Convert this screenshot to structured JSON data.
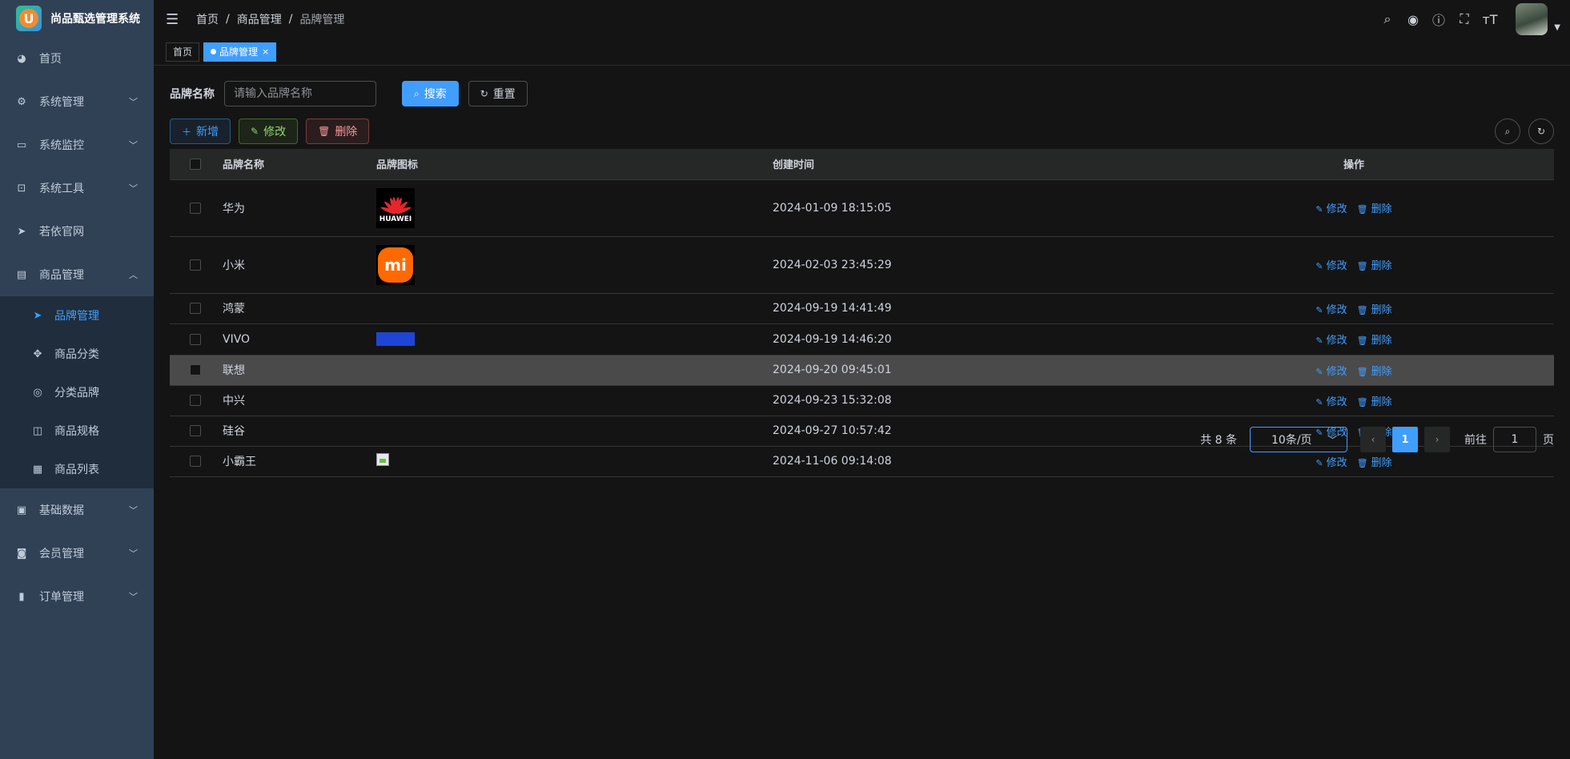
{
  "app": {
    "title": "尚品甄选管理系统",
    "logo_letter": "U"
  },
  "sidebar": {
    "items": [
      {
        "label": "首页",
        "icon": "dashboard-icon"
      },
      {
        "label": "系统管理",
        "icon": "gear-icon"
      },
      {
        "label": "系统监控",
        "icon": "monitor-icon"
      },
      {
        "label": "系统工具",
        "icon": "toolbox-icon"
      },
      {
        "label": "若依官网",
        "icon": "paper-plane-icon"
      },
      {
        "label": "商品管理",
        "icon": "calendar-icon"
      },
      {
        "label": "基础数据",
        "icon": "database-icon"
      },
      {
        "label": "会员管理",
        "icon": "member-icon"
      },
      {
        "label": "订单管理",
        "icon": "bar-chart-icon"
      }
    ],
    "submenu": [
      {
        "label": "品牌管理",
        "icon": "paper-plane-icon"
      },
      {
        "label": "商品分类",
        "icon": "move-icon"
      },
      {
        "label": "分类品牌",
        "icon": "swirl-icon"
      },
      {
        "label": "商品规格",
        "icon": "columns-icon"
      },
      {
        "label": "商品列表",
        "icon": "grid-icon"
      }
    ]
  },
  "navbar": {
    "breadcrumb": [
      "首页",
      "商品管理",
      "品牌管理"
    ],
    "icons": [
      "search-icon",
      "github-icon",
      "question-icon",
      "fullscreen-icon",
      "font-size-icon"
    ]
  },
  "tags": [
    {
      "label": "首页"
    },
    {
      "label": "品牌管理"
    }
  ],
  "search": {
    "label": "品牌名称",
    "placeholder": "请输入品牌名称",
    "search_label": "搜索",
    "reset_label": "重置"
  },
  "toolbar": {
    "add_label": "新增",
    "edit_label": "修改",
    "delete_label": "删除"
  },
  "table": {
    "headers": [
      "品牌名称",
      "品牌图标",
      "创建时间",
      "操作"
    ],
    "rows": [
      {
        "name": "华为",
        "logo": "huawei",
        "logo_text": "HUAWEI",
        "time": "2024-01-09 18:15:05"
      },
      {
        "name": "小米",
        "logo": "xiaomi",
        "logo_text": "mi",
        "time": "2024-02-03 23:45:29"
      },
      {
        "name": "鸿蒙",
        "logo": "none",
        "logo_text": "",
        "time": "2024-09-19 14:41:49"
      },
      {
        "name": "VIVO",
        "logo": "vivo",
        "logo_text": "",
        "time": "2024-09-19 14:46:20"
      },
      {
        "name": "联想",
        "logo": "none",
        "logo_text": "",
        "time": "2024-09-20 09:45:01"
      },
      {
        "name": "中兴",
        "logo": "none",
        "logo_text": "",
        "time": "2024-09-23 15:32:08"
      },
      {
        "name": "硅谷",
        "logo": "none",
        "logo_text": "",
        "time": "2024-09-27 10:57:42"
      },
      {
        "name": "小霸王",
        "logo": "broken",
        "logo_text": "",
        "time": "2024-11-06 09:14:08"
      }
    ],
    "op_edit": "修改",
    "op_delete": "删除"
  },
  "pagination": {
    "total_text": "共 8 条",
    "page_size": "10条/页",
    "current_page": "1",
    "goto_prefix": "前往",
    "goto_value": "1",
    "goto_suffix": "页"
  },
  "colors": {
    "primary": "#409eff",
    "sidebar_bg": "#304156",
    "submenu_bg": "#1f2d3d",
    "page_bg": "#141414"
  }
}
